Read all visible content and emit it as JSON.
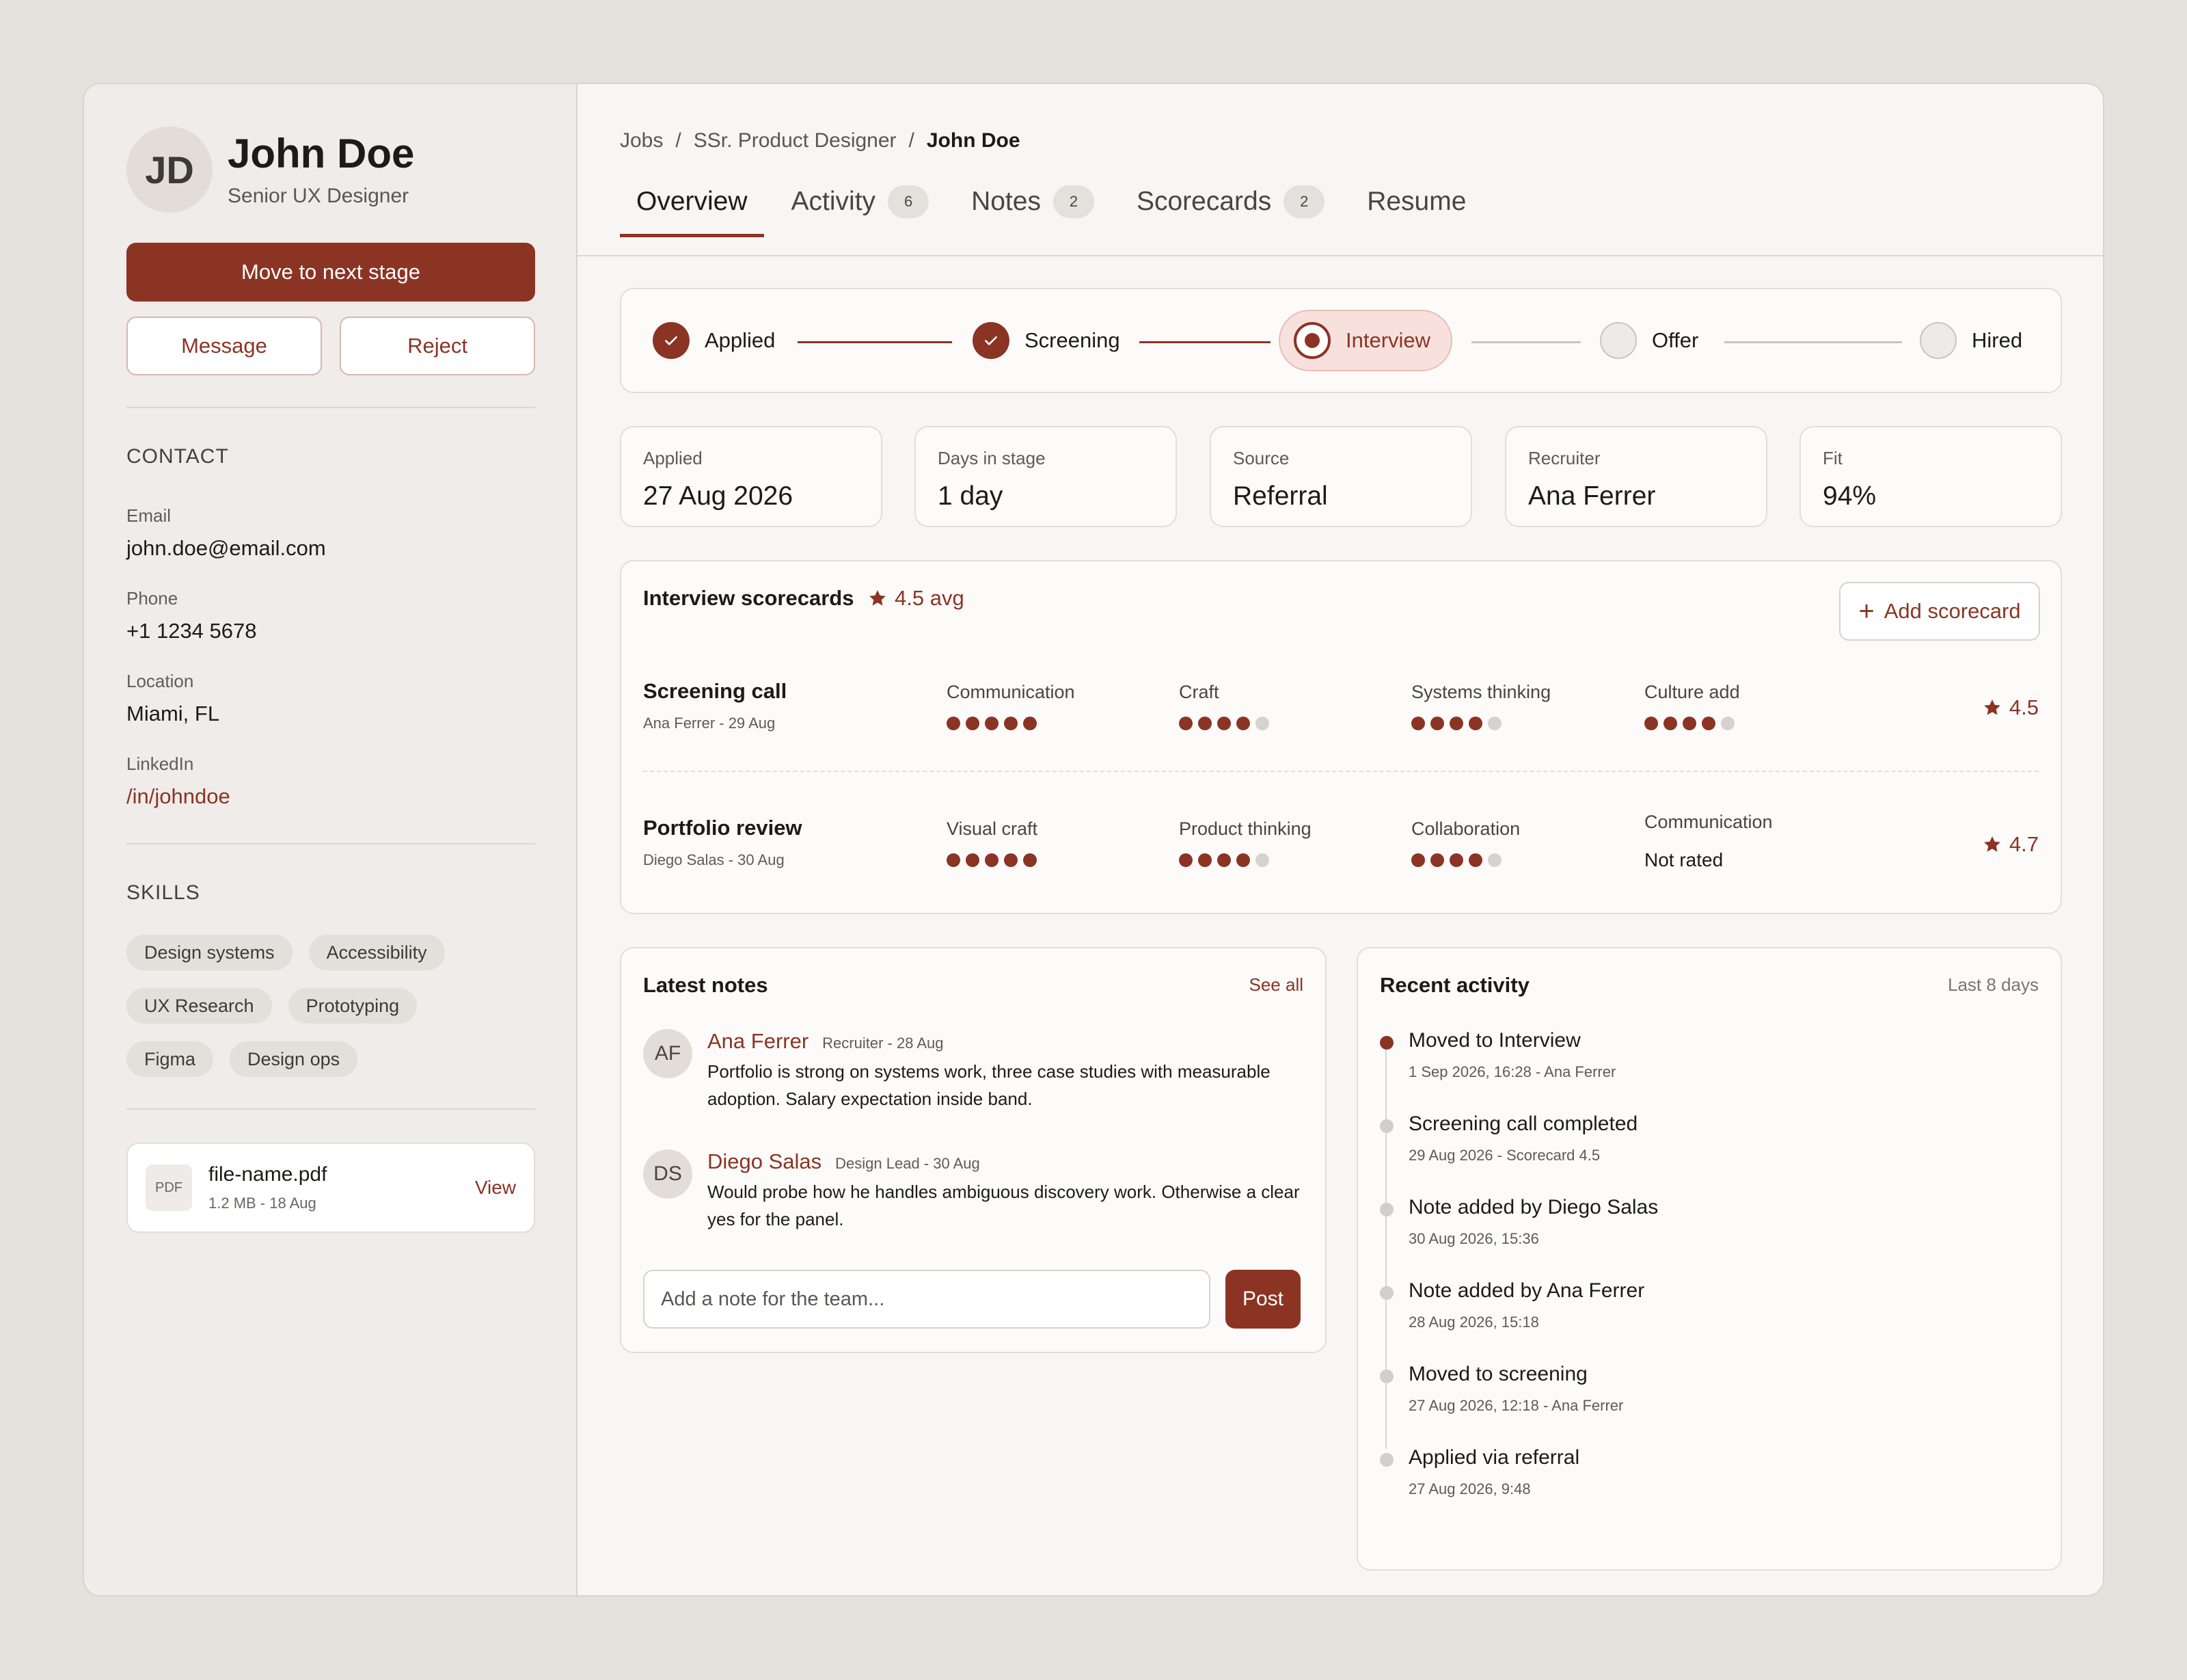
{
  "candidate": {
    "initials": "JD",
    "name": "John Doe",
    "role": "Senior UX Designer"
  },
  "actions": {
    "primary": "Move to next stage",
    "message": "Message",
    "reject": "Reject"
  },
  "contact": {
    "title": "CONTACT",
    "email_label": "Email",
    "email": "john.doe@email.com",
    "phone_label": "Phone",
    "phone": "+1 1234 5678",
    "location_label": "Location",
    "location": "Miami, FL",
    "linkedin_label": "LinkedIn",
    "linkedin": "/in/johndoe"
  },
  "skills": {
    "title": "SKILLS",
    "items": [
      "Design systems",
      "Accessibility",
      "UX Research",
      "Prototyping",
      "Figma",
      "Design ops"
    ]
  },
  "file": {
    "type": "PDF",
    "name": "file-name.pdf",
    "meta": "1.2 MB - 18 Aug",
    "view": "View"
  },
  "breadcrumb": [
    "Jobs",
    "/",
    "SSr. Product Designer",
    "/",
    "John Doe"
  ],
  "tabs": [
    {
      "label": "Overview",
      "count": ""
    },
    {
      "label": "Activity",
      "count": "6"
    },
    {
      "label": "Notes",
      "count": "2"
    },
    {
      "label": "Scorecards",
      "count": "2"
    },
    {
      "label": "Resume",
      "count": ""
    }
  ],
  "pipeline": [
    {
      "label": "Applied",
      "status": "done"
    },
    {
      "label": "Screening",
      "status": "done"
    },
    {
      "label": "Interview",
      "status": "current"
    },
    {
      "label": "Offer",
      "status": "todo"
    },
    {
      "label": "Hired",
      "status": "todo"
    }
  ],
  "stats": [
    {
      "label": "Applied",
      "value": "27 Aug 2026"
    },
    {
      "label": "Days in stage",
      "value": "1 day"
    },
    {
      "label": "Source",
      "value": "Referral"
    },
    {
      "label": "Recruiter",
      "value": "Ana Ferrer"
    },
    {
      "label": "Fit",
      "value": "94%"
    }
  ],
  "scorecards": {
    "title": "Interview scorecards",
    "avg": "4.5 avg",
    "add_label": "Add scorecard",
    "rows": [
      {
        "name": "Screening call",
        "meta": "Ana Ferrer - 29 Aug",
        "score": "4.5",
        "criteria": [
          {
            "label": "Communication",
            "rating": 5
          },
          {
            "label": "Craft",
            "rating": 4
          },
          {
            "label": "Systems thinking",
            "rating": 4
          },
          {
            "label": "Culture add",
            "rating": 4
          }
        ]
      },
      {
        "name": "Portfolio review",
        "meta": "Diego Salas - 30 Aug",
        "score": "4.7",
        "criteria": [
          {
            "label": "Visual craft",
            "rating": 5
          },
          {
            "label": "Product thinking",
            "rating": 4
          },
          {
            "label": "Collaboration",
            "rating": 4
          },
          {
            "label": "Communication",
            "rating": null,
            "text": "Not rated"
          }
        ]
      }
    ]
  },
  "notes": {
    "title": "Latest notes",
    "see_all": "See all",
    "items": [
      {
        "initials": "AF",
        "author": "Ana Ferrer",
        "meta": "Recruiter - 28 Aug",
        "body": "Portfolio is strong on systems work, three case studies with measurable adoption. Salary expectation inside band."
      },
      {
        "initials": "DS",
        "author": "Diego Salas",
        "meta": "Design Lead - 30 Aug",
        "body": "Would probe how he handles ambiguous discovery work. Otherwise a clear yes for the panel."
      }
    ],
    "placeholder": "Add a note for the team...",
    "post": "Post"
  },
  "activity": {
    "title": "Recent activity",
    "range": "Last 8 days",
    "items": [
      {
        "title": "Moved to Interview",
        "meta": "1 Sep 2026, 16:28 - Ana Ferrer"
      },
      {
        "title": "Screening call completed",
        "meta": "29 Aug 2026 - Scorecard 4.5"
      },
      {
        "title": "Note added by Diego Salas",
        "meta": "30 Aug 2026, 15:36"
      },
      {
        "title": "Note added by Ana Ferrer",
        "meta": "28 Aug 2026, 15:18"
      },
      {
        "title": "Moved to screening",
        "meta": "27 Aug 2026, 12:18 - Ana Ferrer"
      },
      {
        "title": "Applied via referral",
        "meta": "27 Aug 2026, 9:48"
      }
    ]
  },
  "colors": {
    "accent": "#8b3424",
    "background": "#e5e1dd",
    "sidebar": "#efece9"
  }
}
